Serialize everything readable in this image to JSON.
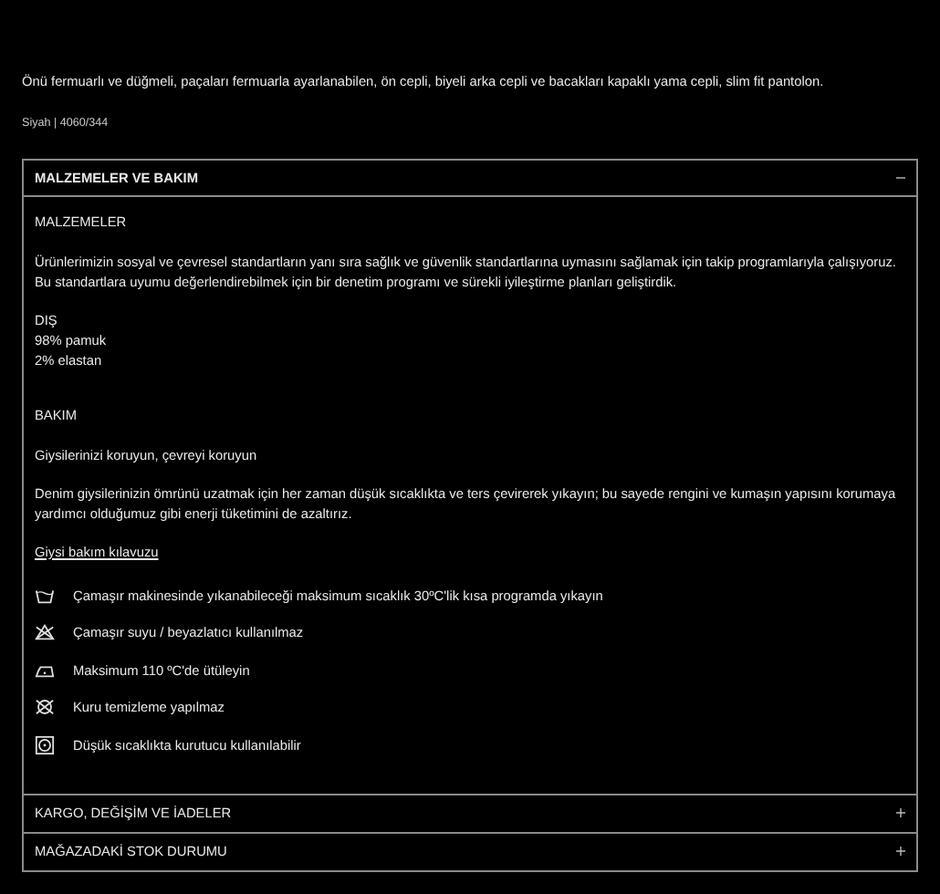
{
  "description": "Önü fermuarlı ve düğmeli, paçaları fermuarla ayarlanabilen, ön cepli, biyeli arka cepli ve bacakları kapaklı yama cepli, slim fit pantolon.",
  "color_code": "Siyah | 4060/344",
  "sections": [
    {
      "title": "MALZEMELER VE BAKIM",
      "expanded": true,
      "materials": {
        "heading": "MALZEMELER",
        "text": "Ürünlerimizin sosyal ve çevresel standartların yanı sıra sağlık ve güvenlik standartlarına uymasını sağlamak için takip programlarıyla çalışıyoruz. Bu standartlara uyumu değerlendirebilmek için bir denetim programı ve sürekli iyileştirme planları geliştirdik.",
        "part": "DIŞ",
        "composition": [
          "98% pamuk",
          "2% elastan"
        ]
      },
      "care": {
        "heading": "BAKIM",
        "subheading": "Giysilerinizi koruyun, çevreyi koruyun",
        "text": "Denim giysilerinizin ömrünü uzatmak için her zaman düşük sıcaklıkta ve ters çevirerek yıkayın; bu sayede rengini ve kumaşın yapısını korumaya yardımcı olduğumuz gibi enerji tüketimini de azaltırız.",
        "link": "Giysi bakım kılavuzu",
        "instructions": [
          {
            "kind": "wash",
            "text": "Çamaşır makinesinde yıkanabileceği maksimum sıcaklık 30ºC'lik kısa programda yıkayın"
          },
          {
            "kind": "no-bleach",
            "text": "Çamaşır suyu / beyazlatıcı kullanılmaz"
          },
          {
            "kind": "iron",
            "text": "Maksimum 110 ºC'de ütüleyin"
          },
          {
            "kind": "no-dry-clean",
            "text": "Kuru temizleme yapılmaz"
          },
          {
            "kind": "tumble-dry",
            "text": "Düşük sıcaklıkta kurutucu kullanılabilir"
          }
        ]
      }
    },
    {
      "title": "KARGO, DEĞİŞİM VE İADELER",
      "expanded": false
    },
    {
      "title": "MAĞAZADAKİ STOK DURUMU",
      "expanded": false
    }
  ]
}
